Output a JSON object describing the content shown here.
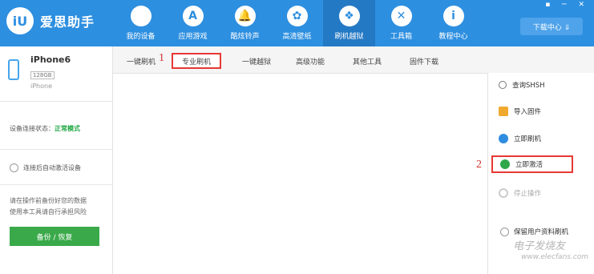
{
  "app": {
    "logo_glyph": "iU",
    "name": "爱思助手"
  },
  "nav": [
    {
      "label": "我的设备",
      "glyph": ""
    },
    {
      "label": "应用游戏",
      "glyph": "A"
    },
    {
      "label": "酷炫铃声",
      "glyph": "🔔"
    },
    {
      "label": "高清壁纸",
      "glyph": "✿"
    },
    {
      "label": "刷机越狱",
      "glyph": "❖"
    },
    {
      "label": "工具箱",
      "glyph": "✕"
    },
    {
      "label": "教程中心",
      "glyph": "i"
    }
  ],
  "window_controls": "▪ ─ ✕",
  "download_center": "下载中心 ⇓",
  "device": {
    "name": "iPhone6",
    "capacity": "128GB",
    "model": "iPhone"
  },
  "status": {
    "label": "设备连接状态：",
    "value": "正常模式"
  },
  "auto_activate": "连接后自动激活设备",
  "warning": "请在操作前备份好您的数据\n使用本工具请自行承担风险",
  "backup_button": "备份 / 恢复",
  "tabs": [
    {
      "label": "一键刷机"
    },
    {
      "label": "专业刷机"
    },
    {
      "label": "一键越狱"
    },
    {
      "label": "高级功能"
    },
    {
      "label": "其他工具"
    },
    {
      "label": "固件下载"
    }
  ],
  "annotations": {
    "one": "1",
    "two": "2"
  },
  "actions": [
    {
      "label": "查询SHSH"
    },
    {
      "label": "导入固件"
    },
    {
      "label": "立即刷机"
    },
    {
      "label": "立即激活"
    },
    {
      "label": "停止操作"
    }
  ],
  "keep_data": "保留用户资料刷机",
  "watermark": "电子发烧友",
  "watermark_url": "www.elecfans.com",
  "colors": {
    "topbar": "#2d8fe0",
    "success": "#1fa843",
    "highlight": "#e53935",
    "button_green": "#3aa94a"
  }
}
